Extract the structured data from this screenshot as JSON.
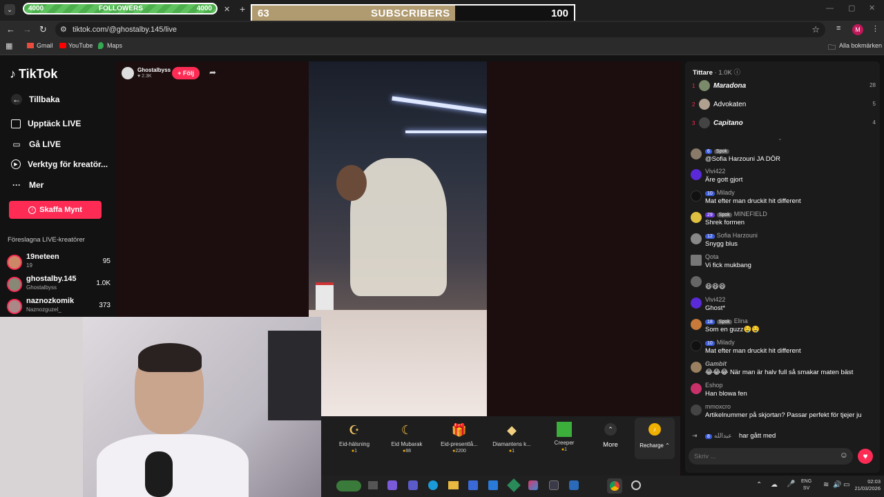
{
  "overlays": {
    "followers": {
      "label": "FOLLOWERS",
      "current": "4000",
      "goal": "4000"
    },
    "subscribers": {
      "label": "SUBSCRIBERS",
      "current": "63",
      "goal": "100",
      "progress": 0.63
    }
  },
  "browser": {
    "url": "tiktok.com/@ghostalby.145/live",
    "bookmarks": [
      "Gmail",
      "YouTube",
      "Maps"
    ],
    "all_bookmarks": "Alla bokmärken",
    "profile_initial": "M"
  },
  "sidebar": {
    "logo": "TikTok",
    "back": "Tillbaka",
    "items": [
      {
        "label": "Upptäck LIVE",
        "icon": "calendar-live-icon"
      },
      {
        "label": "Gå LIVE",
        "icon": "camera-icon"
      },
      {
        "label": "Verktyg för kreatör...",
        "icon": "play-circle-icon"
      },
      {
        "label": "Mer",
        "icon": "more-dots-icon"
      }
    ],
    "buy_coins": "Skaffa Mynt",
    "suggested_title": "Föreslagna LIVE-kreatörer",
    "creators": [
      {
        "name": "19neteen",
        "sub": "19",
        "count": "95"
      },
      {
        "name": "ghostalby.145",
        "sub": "Ghostalbyss",
        "count": "1.0K"
      },
      {
        "name": "naznozkomik",
        "sub": "Naznozguzel_",
        "count": "373"
      }
    ]
  },
  "streamer": {
    "name": "Ghostalbyss",
    "likes": "2.3K",
    "follow": "+ Följ"
  },
  "viewers": {
    "title": "Tittare",
    "count": "1.0K",
    "ranking": [
      {
        "rank": "1",
        "name": "Maradona",
        "score": "28"
      },
      {
        "rank": "2",
        "name": "Advokaten",
        "score": "5"
      },
      {
        "rank": "3",
        "name": "Capitano",
        "score": "4"
      }
    ]
  },
  "chat": [
    {
      "name": "Spok",
      "msg": "@Sofia Harzouni JA DÖR",
      "color": "#8a7a6a"
    },
    {
      "name": "Vivi422",
      "msg": "Äre gott gjort",
      "color": "#5a2ad8"
    },
    {
      "name": "Milady",
      "msg": "Mat efter man druckit hit different",
      "color": "#111111"
    },
    {
      "name": "MINEFIELD",
      "msg": "Shrek formen",
      "color": "#e0c040"
    },
    {
      "name": "Sofia Harzouni",
      "msg": "Snygg blus",
      "color": "#888888"
    },
    {
      "name": "Qota",
      "msg": "Vi fick mukbang",
      "color": "#777777"
    },
    {
      "name": "",
      "msg": "😆😆😆",
      "color": "#666666"
    },
    {
      "name": "Vivi422",
      "msg": "Ghost*",
      "color": "#5a2ad8"
    },
    {
      "name": "Elina",
      "msg": "Som en guzz🤤🤤",
      "color": "#c87a3a"
    },
    {
      "name": "Milady",
      "msg": "Mat efter man druckit hit different",
      "color": "#111111"
    },
    {
      "name": "Gambit",
      "msg": "😂😂😂 När man är halv full så smakar maten bäst",
      "color": "#9a8060"
    },
    {
      "name": "Eshop",
      "msg": "Han blowa fen",
      "color": "#c8306a"
    },
    {
      "name": "mmoxcro",
      "msg": "Artikelnummer på skjortan? Passar perfekt för tjejer ju",
      "color": "#444444"
    },
    {
      "name": "عبدالله",
      "msg": "har gått med",
      "color": "#555555"
    }
  ],
  "chat_input": {
    "placeholder": "Skriv ..."
  },
  "gifts": [
    {
      "name": "Eid-hälsning",
      "price": "1",
      "icon": "eid-greeting-icon"
    },
    {
      "name": "Eid Mubarak",
      "price": "88",
      "icon": "eid-mubarak-icon"
    },
    {
      "name": "Eid-presentlå...",
      "price": "2200",
      "icon": "gift-box-icon"
    },
    {
      "name": "Diamantens k...",
      "price": "1",
      "icon": "diamond-icon"
    },
    {
      "name": "Creeper",
      "price": "1",
      "icon": "creeper-icon"
    }
  ],
  "gift_more": "More",
  "recharge": "Recharge",
  "taskbar": {
    "lang": "ENG",
    "region": "SV",
    "time": "02:03",
    "date": "21/03/2026"
  },
  "colors": {
    "accent": "#fe2c55",
    "subs_fill": "#b09a70",
    "followers_green": "#4cae4c"
  }
}
